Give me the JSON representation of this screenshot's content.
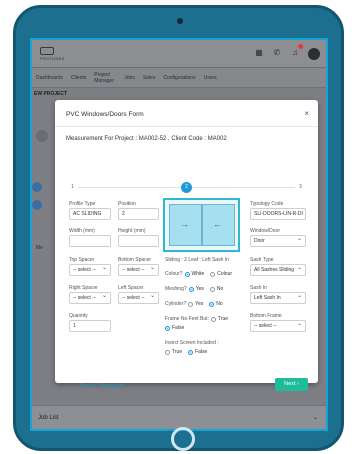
{
  "app": {
    "logo_text": "PROTUNES",
    "page_title": "EW PROJECT",
    "nav": [
      "Dashboards",
      "Clients",
      "Project Manager",
      "Jobs",
      "Sales",
      "Configurations",
      "Users"
    ],
    "header_icons": [
      "grid-icon",
      "call-icon",
      "bell-icon",
      "user-icon"
    ],
    "joblist_label": "Job List",
    "side_label": "Me"
  },
  "modal": {
    "title": "PVC Windows/Doors Form",
    "project_line": "Measurement For Project : MA002-52 , Client Code : MA002",
    "steps": [
      "1",
      "2",
      "3"
    ],
    "active_step": 2,
    "fields": {
      "profile_type_label": "Profile Type",
      "profile_type_value": "AC SLIDING",
      "position_label": "Position",
      "position_value": "2",
      "width_label": "Width (mm)",
      "width_value": "",
      "height_label": "Height (mm)",
      "height_value": "",
      "top_spacer_label": "Top Spacer",
      "top_spacer_value": "-- select --",
      "bottom_spacer_label": "Bottom Spacer",
      "bottom_spacer_value": "-- select --",
      "right_spacer_label": "Right Spacer",
      "right_spacer_value": "-- select --",
      "left_spacer_label": "Left Spacer",
      "left_spacer_value": "-- select --",
      "quantity_label": "Quantity",
      "quantity_value": "1",
      "typology_code_label": "Typology Code",
      "typology_code_value": "SLI-DOORS-LIN-R-DI",
      "window_door_label": "Window/Door",
      "window_door_value": "Door",
      "sash_type_label": "Sash Type",
      "sash_type_value": "All Sashes Sliding",
      "sash_in_label": "Sash In",
      "sash_in_value": "Left Sash In",
      "bottom_frame_label": "Bottom Frame",
      "bottom_frame_value": "-- select --"
    },
    "sliding_caption": "Sliding : 2 Leaf : Left Sash In",
    "colour": {
      "label": "Colour?",
      "options": [
        "White",
        "Colour"
      ],
      "selected": "White"
    },
    "meshing": {
      "label": "Meshing?",
      "options": [
        "Yes",
        "No"
      ],
      "selected": "Yes"
    },
    "cylinder": {
      "label": "Cylinder?",
      "options": [
        "Yes",
        "No"
      ],
      "selected": "No"
    },
    "frame_no_feet": {
      "label": "Frame No Feet But:",
      "options": [
        "True",
        "False"
      ],
      "selected": "False"
    },
    "insect_screen": {
      "label": "Insect Screen Included :",
      "options": [
        "True",
        "False"
      ],
      "selected": "False"
    },
    "back_link": "Back to Typology list",
    "next_button": "Next"
  },
  "colors": {
    "accent": "#1d9bd8",
    "next": "#1ebc9a",
    "tablet": "#1d6f8f"
  }
}
